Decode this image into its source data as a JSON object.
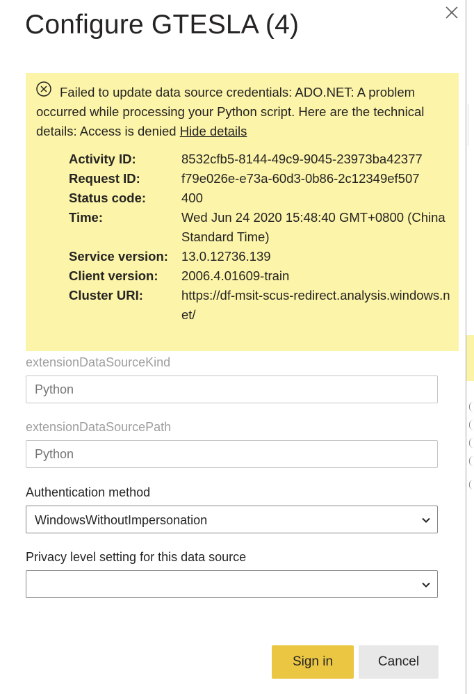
{
  "dialog": {
    "title": "Configure GTESLA (4)",
    "close_icon": "close-icon"
  },
  "error": {
    "icon": "error-circle-x-icon",
    "message": "Failed to update data source credentials: ADO.NET: A problem occurred while processing your Python script. Here are the technical details: Access is denied",
    "hide_details_label": "Hide details",
    "details": [
      {
        "key": "Activity ID:",
        "value": "8532cfb5-8144-49c9-9045-23973ba42377"
      },
      {
        "key": "Request ID:",
        "value": "f79e026e-e73a-60d3-0b86-2c12349ef507"
      },
      {
        "key": "Status code:",
        "value": "400"
      },
      {
        "key": "Time:",
        "value": "Wed Jun 24 2020 15:48:40 GMT+0800 (China Standard Time)"
      },
      {
        "key": "Service version:",
        "value": "13.0.12736.139"
      },
      {
        "key": "Client version:",
        "value": "2006.4.01609-train"
      },
      {
        "key": "Cluster URI:",
        "value": "https://df-msit-scus-redirect.analysis.windows.net/"
      }
    ]
  },
  "form": {
    "kind_label": "extensionDataSourceKind",
    "kind_value": "Python",
    "path_label": "extensionDataSourcePath",
    "path_value": "Python",
    "auth_label": "Authentication method",
    "auth_value": "WindowsWithoutImpersonation",
    "privacy_label": "Privacy level setting for this data source",
    "privacy_value": ""
  },
  "buttons": {
    "sign_in": "Sign in",
    "cancel": "Cancel"
  },
  "colors": {
    "banner_bg": "#fcf4a8",
    "primary_button": "#ebc642",
    "secondary_button": "#e8e8e8"
  }
}
